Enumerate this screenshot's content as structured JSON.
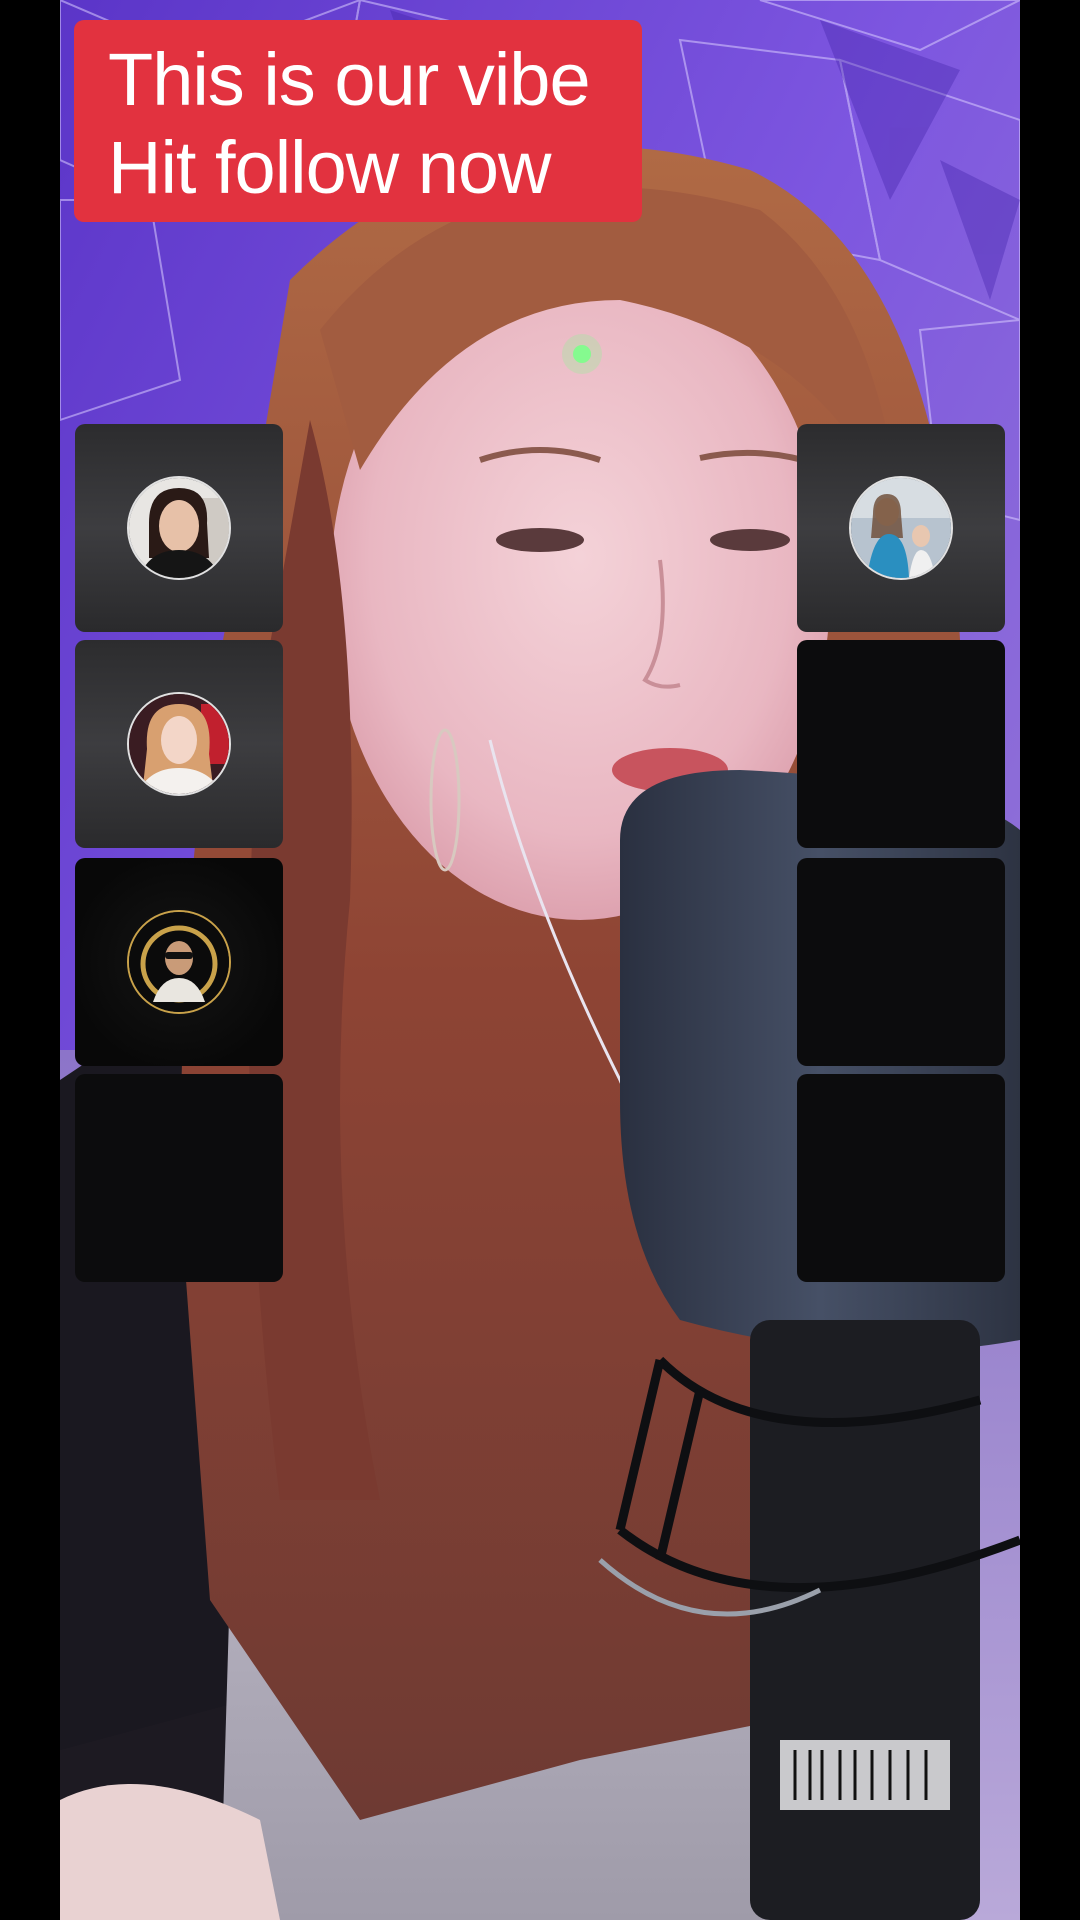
{
  "caption": {
    "line1": "This is our vibe",
    "line2": "Hit follow now"
  },
  "colors": {
    "caption_bg": "#e2323f",
    "caption_text": "#ffffff",
    "seat_filled": "#333335",
    "seat_empty": "#0c0c0d",
    "backdrop_purple": "#6a3fd0"
  },
  "guest_seats": {
    "left": [
      {
        "state": "occupied",
        "avatar": "guest-avatar-woman-dark-hair"
      },
      {
        "state": "occupied",
        "avatar": "guest-avatar-woman-light-hair"
      },
      {
        "state": "occupied",
        "avatar": "guest-avatar-gold-frame-logo"
      },
      {
        "state": "empty"
      }
    ],
    "right": [
      {
        "state": "occupied",
        "avatar": "guest-avatar-two-women"
      },
      {
        "state": "empty"
      },
      {
        "state": "empty"
      },
      {
        "state": "empty"
      }
    ]
  }
}
